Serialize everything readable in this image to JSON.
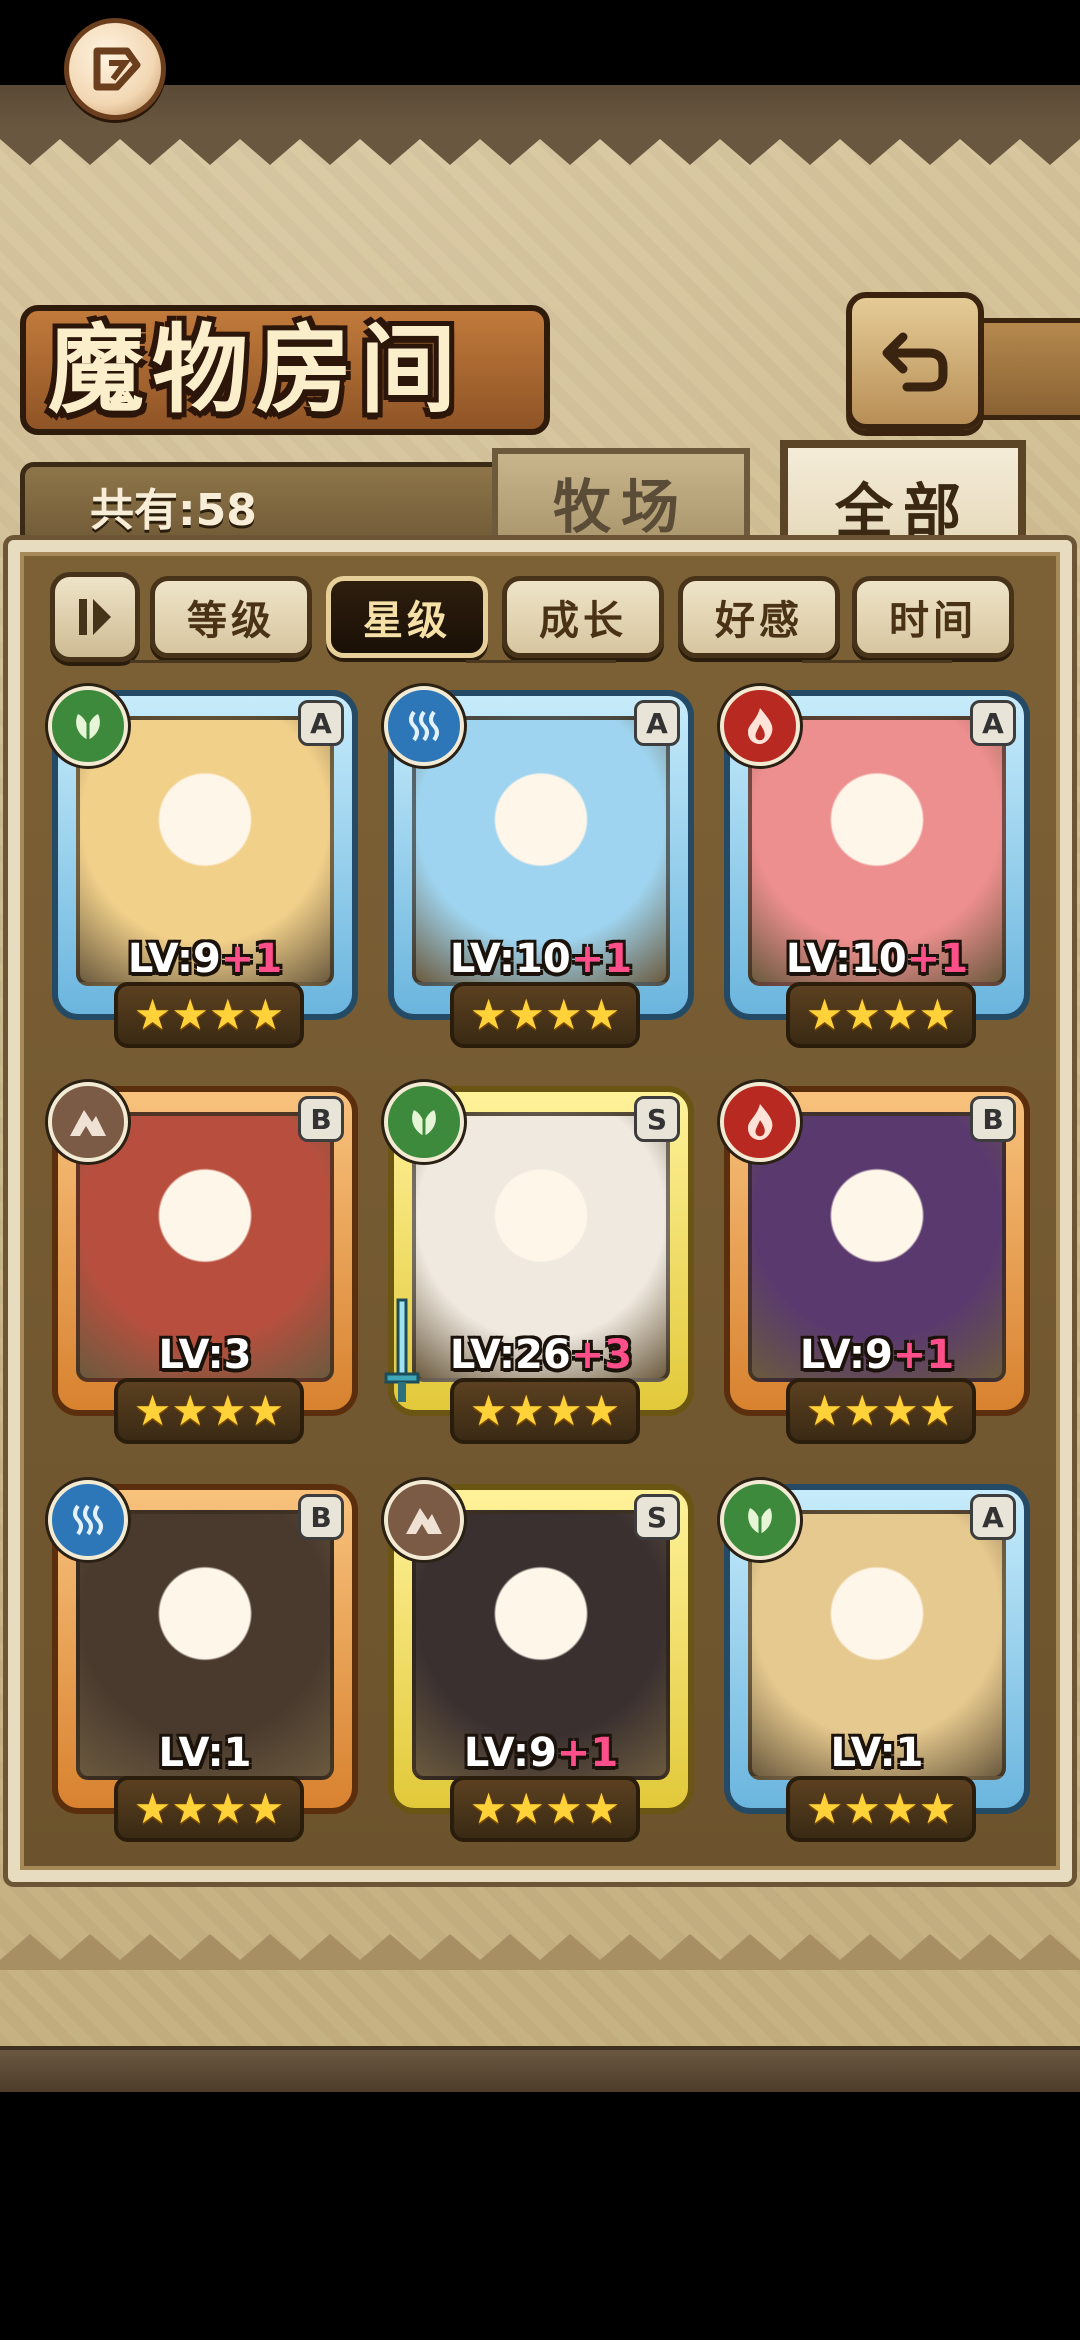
{
  "screen": {
    "title": "魔物房间",
    "count_label": "共有:58"
  },
  "top_tabs": [
    {
      "label": "牧场",
      "active": false
    },
    {
      "label": "全部",
      "active": true
    }
  ],
  "sort_buttons": [
    {
      "label": "等级",
      "active": false
    },
    {
      "label": "星级",
      "active": true
    },
    {
      "label": "成长",
      "active": false
    },
    {
      "label": "好感",
      "active": false
    },
    {
      "label": "时间",
      "active": false
    }
  ],
  "cards": [
    {
      "rank": "A",
      "element": "plant",
      "frame": "blue",
      "level": "LV:9",
      "plus": "+1",
      "stars": 4,
      "portrait": "#f1d08a"
    },
    {
      "rank": "A",
      "element": "water",
      "frame": "blue",
      "level": "LV:10",
      "plus": "+1",
      "stars": 4,
      "portrait": "#9ed4ef"
    },
    {
      "rank": "A",
      "element": "fire",
      "frame": "blue",
      "level": "LV:10",
      "plus": "+1",
      "stars": 4,
      "portrait": "#ee8f8f"
    },
    {
      "rank": "B",
      "element": "earth",
      "frame": "orange",
      "level": "LV:3",
      "plus": "",
      "stars": 4,
      "portrait": "#b84f3e"
    },
    {
      "rank": "S",
      "element": "plant",
      "frame": "gold",
      "level": "LV:26",
      "plus": "+3",
      "stars": 4,
      "portrait": "#efe9e0"
    },
    {
      "rank": "B",
      "element": "fire",
      "frame": "orange",
      "level": "LV:9",
      "plus": "+1",
      "stars": 4,
      "portrait": "#5a3a6e"
    },
    {
      "rank": "B",
      "element": "water",
      "frame": "orange",
      "level": "LV:1",
      "plus": "",
      "stars": 4,
      "portrait": "#4a3a2e"
    },
    {
      "rank": "S",
      "element": "earth",
      "frame": "gold",
      "level": "LV:9",
      "plus": "+1",
      "stars": 4,
      "portrait": "#3a3030"
    },
    {
      "rank": "A",
      "element": "plant",
      "frame": "blue",
      "level": "LV:1",
      "plus": "",
      "stars": 4,
      "portrait": "#e6c98e"
    }
  ]
}
